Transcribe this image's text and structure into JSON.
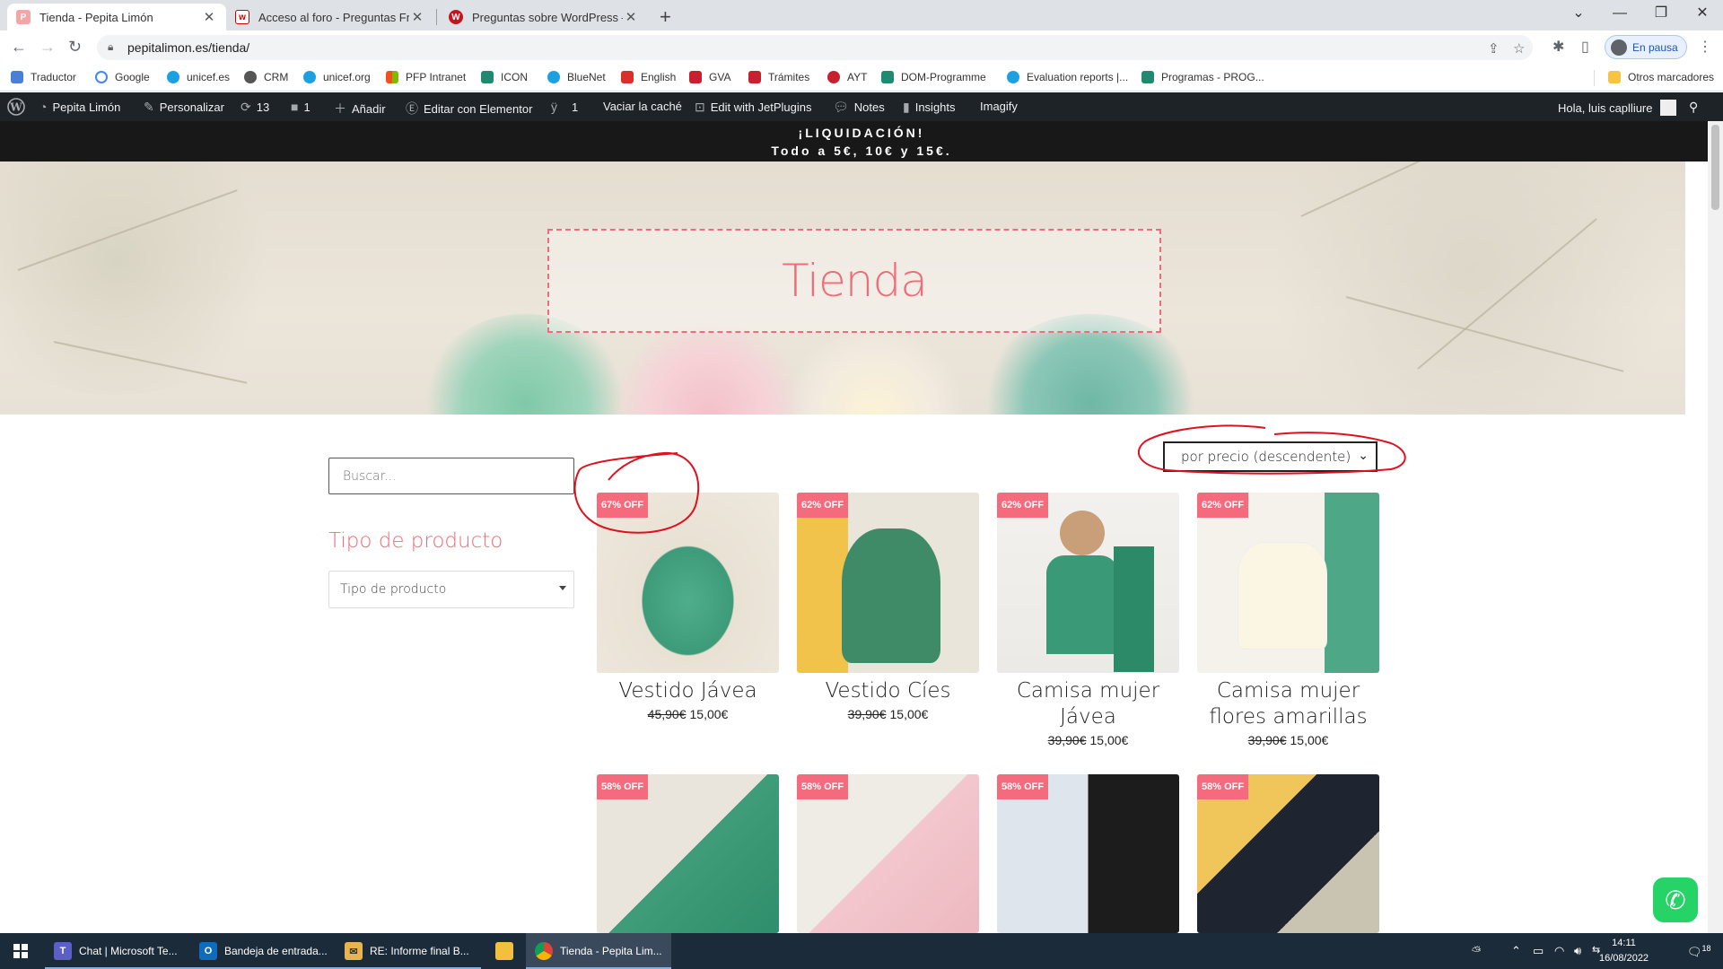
{
  "browser": {
    "tabs": [
      {
        "label": "Tienda - Pepita Limón",
        "active": true
      },
      {
        "label": "Acceso al foro - Preguntas Frecuentes",
        "active": false
      },
      {
        "label": "Preguntas sobre WordPress – Foro",
        "active": false
      }
    ],
    "url": "pepitalimon.es/tienda/",
    "profile_label": "En pausa",
    "bookmarks": [
      "Traductor",
      "Google",
      "unicef.es",
      "CRM",
      "unicef.org",
      "PFP Intranet",
      "ICON",
      "BlueNet",
      "English",
      "GVA",
      "Trámites",
      "AYT",
      "DOM-Programme",
      "Evaluation reports |...",
      "Programas - PROG..."
    ],
    "other_bookmarks": "Otros marcadores"
  },
  "wp_admin": {
    "site": "Pepita Limón",
    "customize": "Personalizar",
    "updates": "13",
    "comments": "1",
    "add_new": "Añadir",
    "elementor": "Editar con Elementor",
    "yoast_count": "1",
    "clear_cache": "Vaciar la caché",
    "jetplugins": "Edit with JetPlugins",
    "notes": "Notes",
    "insights": "Insights",
    "imagify": "Imagify",
    "greeting": "Hola, luis caplliure"
  },
  "announcement": {
    "line1": "¡LIQUIDACIÓN!",
    "line2": "Todo a 5€, 10€ y 15€."
  },
  "hero": {
    "title": "Tienda"
  },
  "shop": {
    "search_placeholder": "Buscar...",
    "filter_title": "Tipo de producto",
    "filter_select": "Tipo de producto",
    "orderby": "por precio (descendente)",
    "products": [
      {
        "badge": "67% OFF",
        "name": "Vestido Jávea",
        "old_price": "45,90€",
        "price": "15,00€"
      },
      {
        "badge": "62% OFF",
        "name": "Vestido Cíes",
        "old_price": "39,90€",
        "price": "15,00€"
      },
      {
        "badge": "62% OFF",
        "name": "Camisa mujer Jávea",
        "old_price": "39,90€",
        "price": "15,00€"
      },
      {
        "badge": "62% OFF",
        "name": "Camisa mujer flores amarillas",
        "old_price": "39,90€",
        "price": "15,00€"
      },
      {
        "badge": "58% OFF"
      },
      {
        "badge": "58% OFF"
      },
      {
        "badge": "58% OFF"
      },
      {
        "badge": "58% OFF"
      }
    ]
  },
  "taskbar": {
    "items": [
      "Chat | Microsoft Te...",
      "Bandeja de entrada...",
      "RE: Informe final B...",
      "Tienda - Pepita Lim..."
    ],
    "time": "14:11",
    "date": "16/08/2022",
    "notif_count": "18"
  },
  "colors": {
    "accent": "#f06c7a",
    "badge": "#f46b7e",
    "wpbar": "#1d2327"
  }
}
